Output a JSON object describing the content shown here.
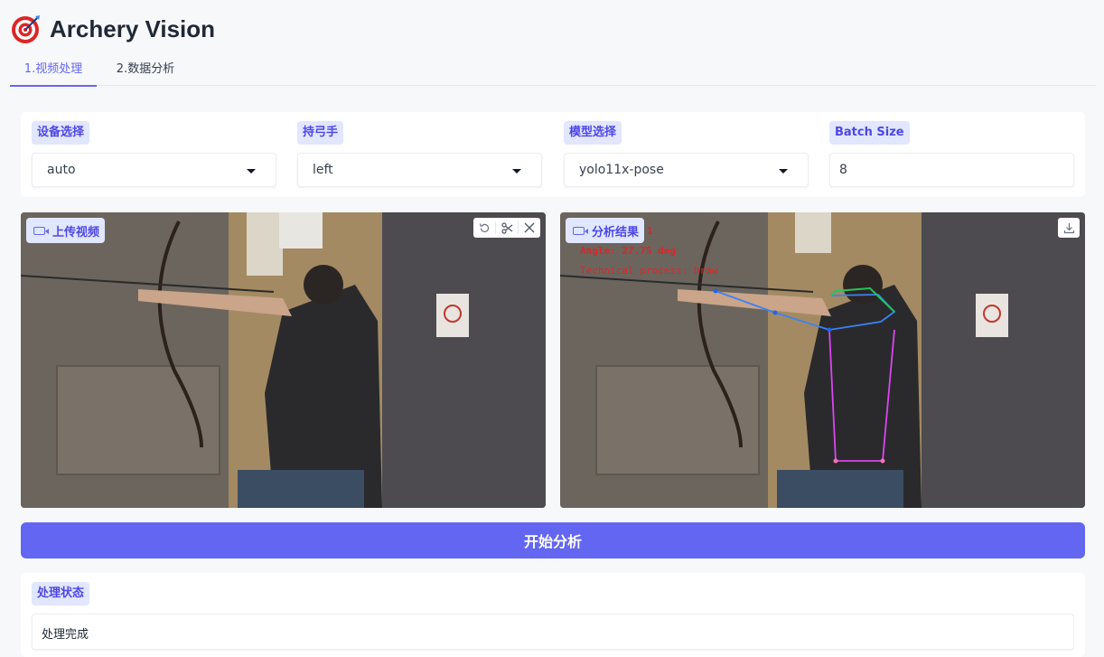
{
  "app": {
    "title": "Archery Vision"
  },
  "tabs": [
    {
      "label": "1.视频处理",
      "active": true
    },
    {
      "label": "2.数据分析",
      "active": false
    }
  ],
  "settings": {
    "device": {
      "label": "设备选择",
      "value": "auto"
    },
    "hand": {
      "label": "持弓手",
      "value": "left"
    },
    "model": {
      "label": "模型选择",
      "value": "yolo11x-pose"
    },
    "batch": {
      "label": "Batch Size",
      "value": "8"
    }
  },
  "upload": {
    "label": "上传视频"
  },
  "result": {
    "label": "分析结果",
    "overlay_frame": "1",
    "overlay_angle": "Angle: 27.75 deg",
    "overlay_process": "Technical process: Draw"
  },
  "actions": {
    "start_label": "开始分析"
  },
  "status": {
    "label": "处理状态",
    "value": "处理完成"
  },
  "colors": {
    "accent": "#6366f1",
    "label_bg": "#e0e7ff",
    "overlay_red": "#dc2626"
  },
  "icons": [
    "target-logo-icon",
    "video-camera-icon",
    "undo-icon",
    "scissors-icon",
    "close-icon",
    "download-icon",
    "chevron-down-icon"
  ]
}
